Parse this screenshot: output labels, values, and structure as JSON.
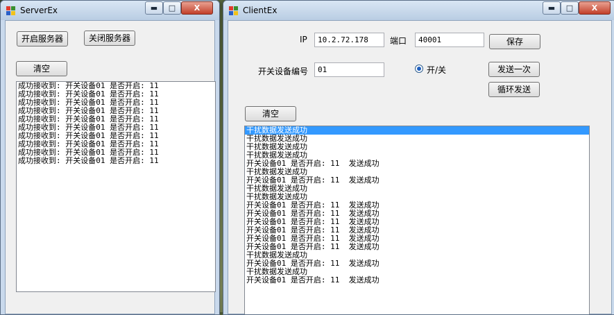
{
  "server": {
    "title": "ServerEx",
    "start_label": "开启服务器",
    "stop_label": "关闭服务器",
    "clear_label": "清空",
    "log": [
      "成功接收到: 开关设备01 是否开启: 11",
      "成功接收到: 开关设备01 是否开启: 11",
      "成功接收到: 开关设备01 是否开启: 11",
      "成功接收到: 开关设备01 是否开启: 11",
      "成功接收到: 开关设备01 是否开启: 11",
      "成功接收到: 开关设备01 是否开启: 11",
      "成功接收到: 开关设备01 是否开启: 11",
      "成功接收到: 开关设备01 是否开启: 11",
      "成功接收到: 开关设备01 是否开启: 11",
      "成功接收到: 开关设备01 是否开启: 11"
    ]
  },
  "client": {
    "title": "ClientEx",
    "ip_label": "IP",
    "ip_value": "10.2.72.178",
    "port_label": "端口",
    "port_value": "40001",
    "save_label": "保存",
    "device_label": "开关设备编号",
    "device_value": "01",
    "radio_label": "开/关",
    "send_once_label": "发送一次",
    "loop_send_label": "循环发送",
    "clear_label": "清空",
    "log": [
      "干扰数据发送成功",
      "干扰数据发送成功",
      "干扰数据发送成功",
      "干扰数据发送成功",
      "开关设备01 是否开启: 11  发送成功",
      "干扰数据发送成功",
      "开关设备01 是否开启: 11  发送成功",
      "干扰数据发送成功",
      "干扰数据发送成功",
      "开关设备01 是否开启: 11  发送成功",
      "开关设备01 是否开启: 11  发送成功",
      "开关设备01 是否开启: 11  发送成功",
      "开关设备01 是否开启: 11  发送成功",
      "开关设备01 是否开启: 11  发送成功",
      "开关设备01 是否开启: 11  发送成功",
      "干扰数据发送成功",
      "开关设备01 是否开启: 11  发送成功",
      "干扰数据发送成功",
      "开关设备01 是否开启: 11  发送成功"
    ],
    "selected_index": 0
  },
  "window_controls": {
    "minimize": "▬",
    "maximize": "□",
    "close": "X"
  }
}
